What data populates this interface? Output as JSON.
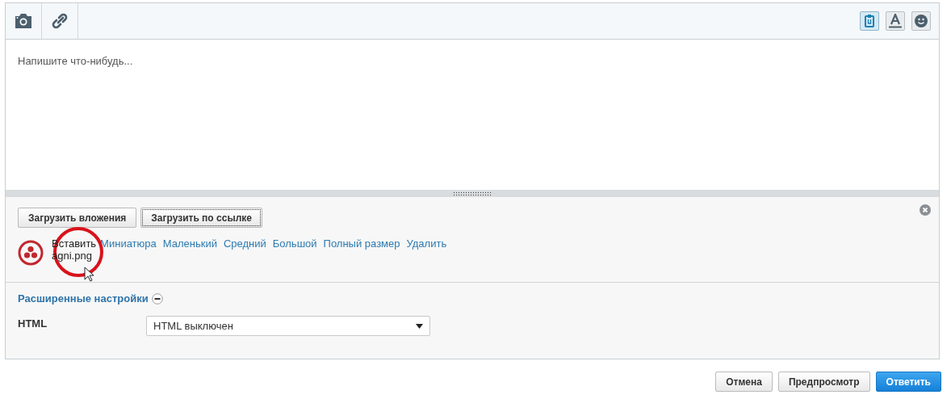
{
  "toolbar": {
    "left_tools": [
      {
        "kind": "camera"
      },
      {
        "kind": "link"
      }
    ],
    "right_tools": [
      {
        "kind": "attach",
        "pressed": true
      },
      {
        "kind": "font",
        "pressed": false
      },
      {
        "kind": "smile",
        "pressed": false
      }
    ]
  },
  "editor": {
    "placeholder": "Напишите что-нибудь..."
  },
  "attachments": {
    "buttons": [
      {
        "label": "Загрузить вложения",
        "focused": false
      },
      {
        "label": "Загрузить по ссылке",
        "focused": true
      }
    ],
    "file": {
      "insert_label": "Вставить",
      "name": "agni.png",
      "actions": [
        "Миниатюра",
        "Маленький",
        "Средний",
        "Большой",
        "Полный размер",
        "Удалить"
      ]
    }
  },
  "advanced": {
    "title": "Расширенные настройки",
    "expanded": true,
    "fields": [
      {
        "label": "HTML",
        "value": "HTML выключен"
      }
    ]
  },
  "footer_buttons": [
    {
      "label": "Отмена",
      "primary": false
    },
    {
      "label": "Предпросмотр",
      "primary": false
    },
    {
      "label": "Ответить",
      "primary": true
    }
  ]
}
